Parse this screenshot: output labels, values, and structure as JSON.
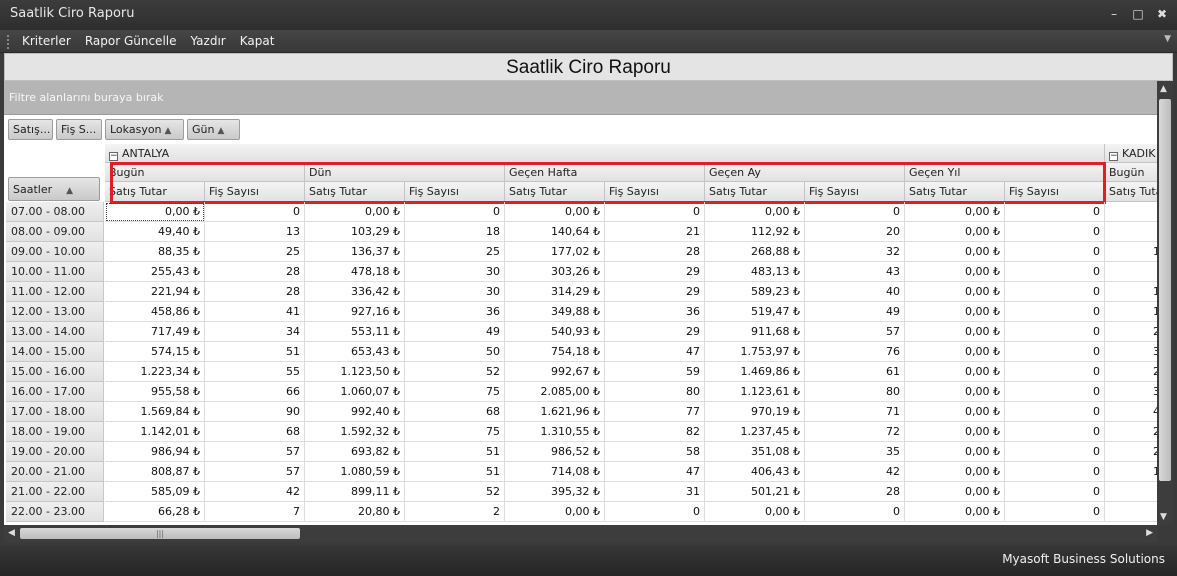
{
  "window": {
    "title": "Saatlik Ciro Raporu"
  },
  "menu": {
    "items": [
      "Kriterler",
      "Rapor Güncelle",
      "Yazdır",
      "Kapat"
    ]
  },
  "report": {
    "title": "Saatlik Ciro Raporu"
  },
  "filter": {
    "hint": "Filtre alanlarını buraya bırak"
  },
  "fields": {
    "data": [
      "Satış...",
      "Fiş S..."
    ],
    "column": [
      "Lokasyon",
      "Gün"
    ],
    "row": "Saatler"
  },
  "locations": [
    "ANTALYA",
    "KADIK"
  ],
  "periods": [
    "Bugün",
    "Dün",
    "Geçen Hafta",
    "Geçen Ay",
    "Geçen Yıl"
  ],
  "measures": [
    "Satış Tutar",
    "Fiş Sayısı"
  ],
  "rows": [
    {
      "hour": "07.00 - 08.00",
      "values": [
        "0,00 ₺",
        "0",
        "0,00 ₺",
        "0",
        "0,00 ₺",
        "0",
        "0,00 ₺",
        "0",
        "0,00 ₺",
        "0"
      ],
      "kadik": ""
    },
    {
      "hour": "08.00 - 09.00",
      "values": [
        "49,40 ₺",
        "13",
        "103,29 ₺",
        "18",
        "140,64 ₺",
        "21",
        "112,92 ₺",
        "20",
        "0,00 ₺",
        "0"
      ],
      "kadik": ""
    },
    {
      "hour": "09.00 - 10.00",
      "values": [
        "88,35 ₺",
        "25",
        "136,37 ₺",
        "25",
        "177,02 ₺",
        "28",
        "268,88 ₺",
        "32",
        "0,00 ₺",
        "0"
      ],
      "kadik": "1"
    },
    {
      "hour": "10.00 - 11.00",
      "values": [
        "255,43 ₺",
        "28",
        "478,18 ₺",
        "30",
        "303,26 ₺",
        "29",
        "483,13 ₺",
        "43",
        "0,00 ₺",
        "0"
      ],
      "kadik": ""
    },
    {
      "hour": "11.00 - 12.00",
      "values": [
        "221,94 ₺",
        "28",
        "336,42 ₺",
        "30",
        "314,29 ₺",
        "29",
        "589,23 ₺",
        "40",
        "0,00 ₺",
        "0"
      ],
      "kadik": "1"
    },
    {
      "hour": "12.00 - 13.00",
      "values": [
        "458,86 ₺",
        "41",
        "927,16 ₺",
        "36",
        "349,88 ₺",
        "36",
        "519,47 ₺",
        "49",
        "0,00 ₺",
        "0"
      ],
      "kadik": "1"
    },
    {
      "hour": "13.00 - 14.00",
      "values": [
        "717,49 ₺",
        "34",
        "553,11 ₺",
        "49",
        "540,93 ₺",
        "29",
        "911,68 ₺",
        "57",
        "0,00 ₺",
        "0"
      ],
      "kadik": "2"
    },
    {
      "hour": "14.00 - 15.00",
      "values": [
        "574,15 ₺",
        "51",
        "653,43 ₺",
        "50",
        "754,18 ₺",
        "47",
        "1.753,97 ₺",
        "76",
        "0,00 ₺",
        "0"
      ],
      "kadik": "3"
    },
    {
      "hour": "15.00 - 16.00",
      "values": [
        "1.223,34 ₺",
        "55",
        "1.123,50 ₺",
        "52",
        "992,67 ₺",
        "59",
        "1.469,86 ₺",
        "61",
        "0,00 ₺",
        "0"
      ],
      "kadik": "2"
    },
    {
      "hour": "16.00 - 17.00",
      "values": [
        "955,58 ₺",
        "66",
        "1.060,07 ₺",
        "75",
        "2.085,00 ₺",
        "80",
        "1.123,61 ₺",
        "80",
        "0,00 ₺",
        "0"
      ],
      "kadik": "3"
    },
    {
      "hour": "17.00 - 18.00",
      "values": [
        "1.569,84 ₺",
        "90",
        "992,40 ₺",
        "68",
        "1.621,96 ₺",
        "77",
        "970,19 ₺",
        "71",
        "0,00 ₺",
        "0"
      ],
      "kadik": "4"
    },
    {
      "hour": "18.00 - 19.00",
      "values": [
        "1.142,01 ₺",
        "68",
        "1.592,32 ₺",
        "75",
        "1.310,55 ₺",
        "82",
        "1.237,45 ₺",
        "72",
        "0,00 ₺",
        "0"
      ],
      "kadik": "2"
    },
    {
      "hour": "19.00 - 20.00",
      "values": [
        "986,94 ₺",
        "57",
        "693,82 ₺",
        "51",
        "986,52 ₺",
        "58",
        "351,08 ₺",
        "35",
        "0,00 ₺",
        "0"
      ],
      "kadik": "2"
    },
    {
      "hour": "20.00 - 21.00",
      "values": [
        "808,87 ₺",
        "57",
        "1.080,59 ₺",
        "51",
        "714,08 ₺",
        "47",
        "406,43 ₺",
        "42",
        "0,00 ₺",
        "0"
      ],
      "kadik": "1"
    },
    {
      "hour": "21.00 - 22.00",
      "values": [
        "585,09 ₺",
        "42",
        "899,11 ₺",
        "52",
        "395,32 ₺",
        "31",
        "501,21 ₺",
        "28",
        "0,00 ₺",
        "0"
      ],
      "kadik": ""
    },
    {
      "hour": "22.00 - 23.00",
      "values": [
        "66,28 ₺",
        "7",
        "20,80 ₺",
        "2",
        "0,00 ₺",
        "0",
        "0,00 ₺",
        "0",
        "0,00 ₺",
        "0"
      ],
      "kadik": ""
    }
  ],
  "status": {
    "brand": "Myasoft Business Solutions"
  },
  "colors": {
    "highlight": "#e31d24"
  }
}
